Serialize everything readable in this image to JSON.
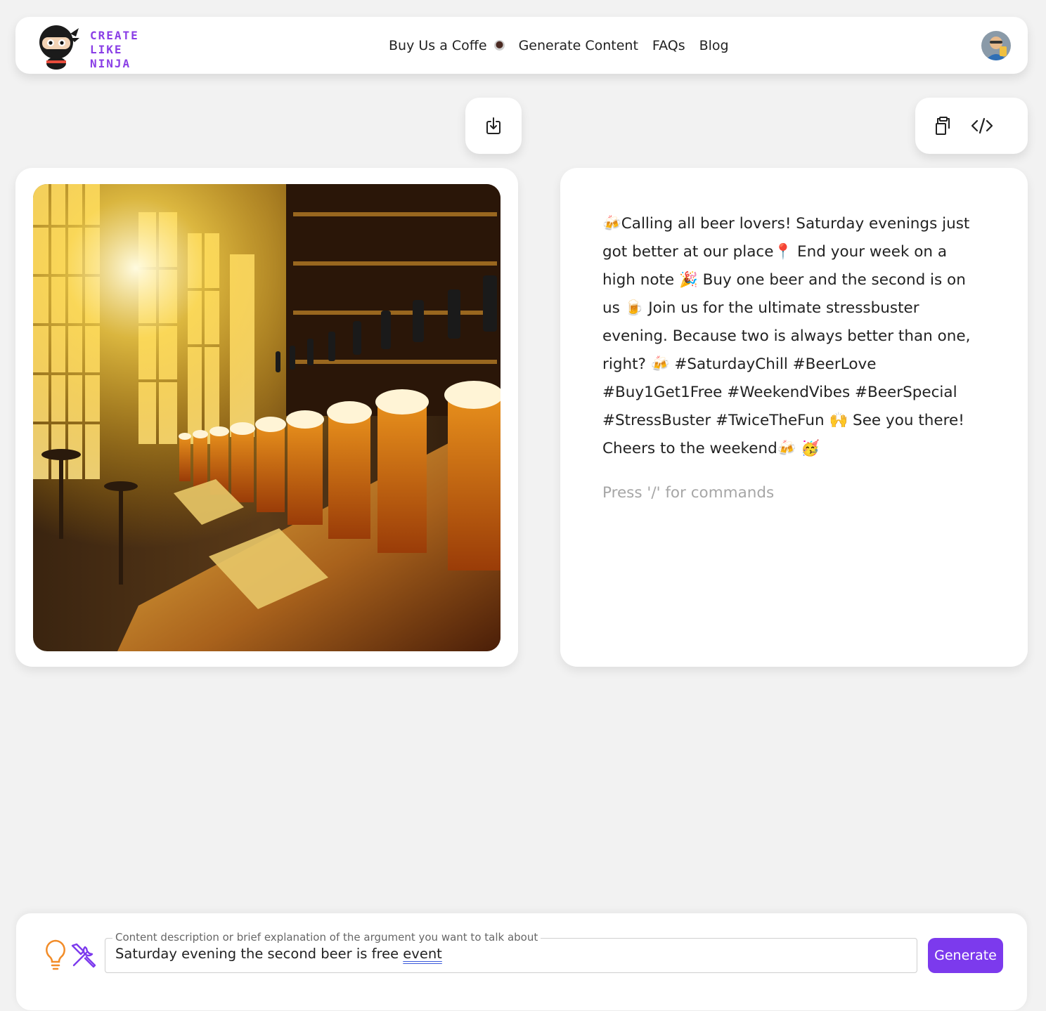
{
  "header": {
    "logo_text": "CREATE LIKE NINJA",
    "nav": [
      {
        "label": "Buy Us a Coffe"
      },
      {
        "label": "Generate Content"
      },
      {
        "label": "FAQs"
      },
      {
        "label": "Blog"
      }
    ]
  },
  "toolbar": {
    "download_icon": "download-icon",
    "copy_icon": "clipboard-copy-icon",
    "code_icon": "code-icon"
  },
  "post": {
    "text": "🍻Calling all beer lovers! Saturday evenings just got better at our place📍 End your week on a high note 🎉 Buy one beer and the second is on us 🍺 Join us for the ultimate stressbuster evening. Because two is always better than one, right? 🍻 #SaturdayChill #BeerLove #Buy1Get1Free #WeekendVibes #BeerSpecial #StressBuster #TwiceTheFun 🙌 See you there! Cheers to the weekend🍻 🥳",
    "commands_hint": "Press '/' for commands"
  },
  "prompt": {
    "label": "Content description or brief explanation of the argument you want to talk about",
    "value_main": "Saturday evening the second beer is free ",
    "value_underlined": "event",
    "generate_label": "Generate"
  },
  "colors": {
    "accent": "#7c3aed",
    "logo": "#8a3ee6",
    "bulb": "#f28c28"
  }
}
